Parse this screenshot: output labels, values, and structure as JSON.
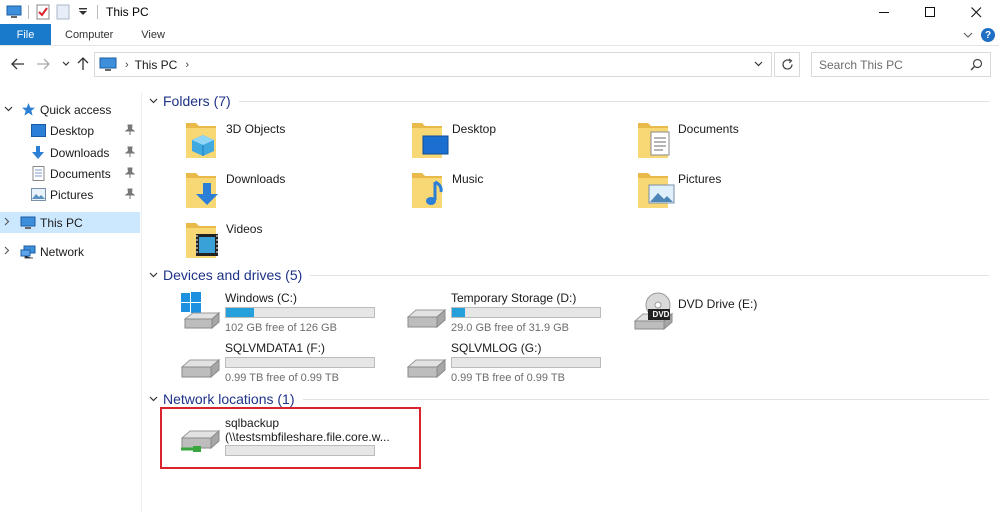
{
  "window": {
    "title": "This PC",
    "controls": {
      "minimize": "—",
      "maximize": "☐",
      "close": "✕"
    }
  },
  "ribbon": {
    "tabs": [
      "File",
      "Computer",
      "View"
    ],
    "help": "?"
  },
  "address": {
    "path": "This PC",
    "search_placeholder": "Search This PC"
  },
  "nav": {
    "quick_access": "Quick access",
    "quick_items": [
      "Desktop",
      "Downloads",
      "Documents",
      "Pictures"
    ],
    "this_pc": "This PC",
    "network": "Network"
  },
  "groups": {
    "folders": "Folders (7)",
    "devices": "Devices and drives (5)",
    "network": "Network locations (1)"
  },
  "folders": [
    "3D Objects",
    "Desktop",
    "Documents",
    "Downloads",
    "Music",
    "Pictures",
    "Videos"
  ],
  "drives": [
    {
      "name": "Windows (C:)",
      "free": "102 GB free of 126 GB",
      "used_fraction": 0.19
    },
    {
      "name": "Temporary Storage (D:)",
      "free": "29.0 GB free of 31.9 GB",
      "used_fraction": 0.09
    },
    {
      "name": "DVD Drive (E:)",
      "label": "DVD"
    },
    {
      "name": "SQLVMDATA1 (F:)",
      "free": "0.99 TB free of 0.99 TB",
      "used_fraction": 0
    },
    {
      "name": "SQLVMLOG (G:)",
      "free": "0.99 TB free of 0.99 TB",
      "used_fraction": 0
    }
  ],
  "network_location": {
    "name": "sqlbackup",
    "path": "(\\\\testsmbfileshare.file.core.w..."
  },
  "colors": {
    "accent": "#1979ca",
    "selection": "#cce8ff",
    "group_title": "#1e3287",
    "bar_fill": "#26a0da",
    "highlight": "#d9232d"
  }
}
